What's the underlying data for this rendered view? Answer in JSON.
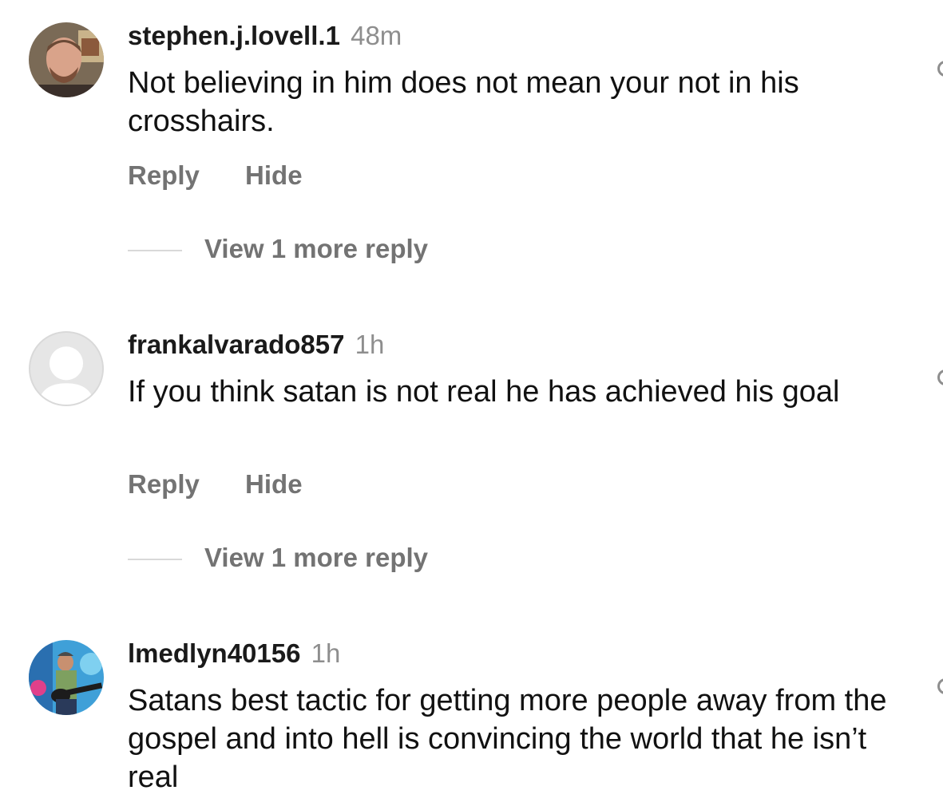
{
  "comments": [
    {
      "username": "stephen.j.lovell.1",
      "time": "48m",
      "text": "Not believing in him does not mean your not in his crosshairs.",
      "reply_label": "Reply",
      "hide_label": "Hide",
      "view_more": "View 1 more reply",
      "avatar": "profile-photo"
    },
    {
      "username": "frankalvarado857",
      "time": "1h",
      "text": "If you think satan is not real he has achieved his goal",
      "reply_label": "Reply",
      "hide_label": "Hide",
      "view_more": "View 1 more reply",
      "avatar": "default-avatar-icon"
    },
    {
      "username": "lmedlyn40156",
      "time": "1h",
      "text": "Satans best tactic for getting more people away from the gospel and into hell is convincing the world that he isn’t real",
      "avatar": "profile-photo-guitar"
    }
  ],
  "colors": {
    "secondary_text": "#737373",
    "timestamp": "#8e8e8e"
  }
}
